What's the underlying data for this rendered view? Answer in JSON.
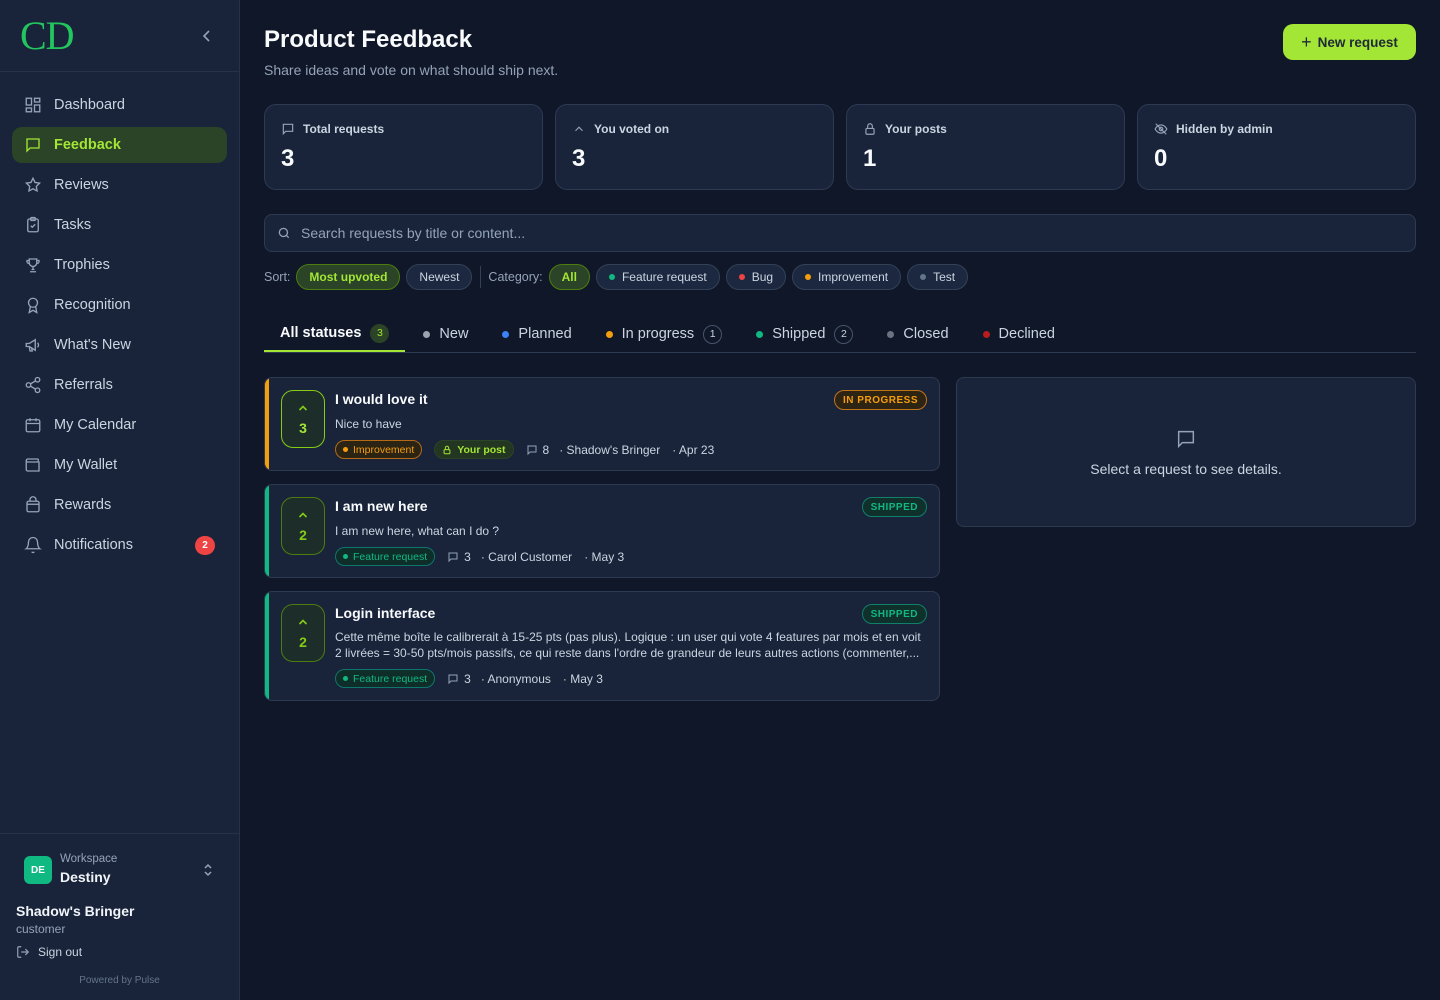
{
  "sidebar": {
    "logo": "CD",
    "nav": [
      {
        "label": "Dashboard",
        "icon": "dashboard-icon"
      },
      {
        "label": "Feedback",
        "icon": "chat-bubble-icon",
        "active": true
      },
      {
        "label": "Reviews",
        "icon": "star-icon"
      },
      {
        "label": "Tasks",
        "icon": "clipboard-icon"
      },
      {
        "label": "Trophies",
        "icon": "trophy-icon"
      },
      {
        "label": "Recognition",
        "icon": "award-icon"
      },
      {
        "label": "What's New",
        "icon": "megaphone-icon"
      },
      {
        "label": "Referrals",
        "icon": "share-icon"
      },
      {
        "label": "My Calendar",
        "icon": "calendar-icon"
      },
      {
        "label": "My Wallet",
        "icon": "wallet-icon"
      },
      {
        "label": "Rewards",
        "icon": "gift-icon"
      },
      {
        "label": "Notifications",
        "icon": "bell-icon",
        "badge": "2"
      }
    ],
    "workspace": {
      "label": "Workspace",
      "name": "Destiny",
      "initials": "DE"
    },
    "user": {
      "name": "Shadow's Bringer",
      "role": "customer"
    },
    "sign_out": "Sign out",
    "powered_by": "Powered by Pulse"
  },
  "header": {
    "title": "Product Feedback",
    "subtitle": "Share ideas and vote on what should ship next.",
    "new_button": "New request"
  },
  "stats": [
    {
      "label": "Total requests",
      "value": "3",
      "icon": "chat-bubble-icon"
    },
    {
      "label": "You voted on",
      "value": "3",
      "icon": "chevron-up-icon"
    },
    {
      "label": "Your posts",
      "value": "1",
      "icon": "lock-icon"
    },
    {
      "label": "Hidden by admin",
      "value": "0",
      "icon": "eye-off-icon"
    }
  ],
  "search": {
    "placeholder": "Search requests by title or content...",
    "value": ""
  },
  "filters": {
    "sort_label": "Sort:",
    "sort": [
      {
        "label": "Most upvoted",
        "active": true
      },
      {
        "label": "Newest"
      }
    ],
    "category_label": "Category:",
    "categories": [
      {
        "label": "All",
        "active": true
      },
      {
        "label": "Feature request",
        "color": "#10b981"
      },
      {
        "label": "Bug",
        "color": "#ef4444"
      },
      {
        "label": "Improvement",
        "color": "#f59e0b"
      },
      {
        "label": "Test",
        "color": "#64748b"
      }
    ]
  },
  "tabs": [
    {
      "label": "All statuses",
      "count": "3",
      "active": true
    },
    {
      "label": "New",
      "color": "#9ca3af"
    },
    {
      "label": "Planned",
      "color": "#3b82f6"
    },
    {
      "label": "In progress",
      "color": "#f59e0b",
      "count": "1"
    },
    {
      "label": "Shipped",
      "color": "#10b981",
      "count": "2"
    },
    {
      "label": "Closed",
      "color": "#6b7280"
    },
    {
      "label": "Declined",
      "color": "#b91c1c"
    }
  ],
  "requests": [
    {
      "votes": "3",
      "title": "I would love it",
      "description": "Nice to have",
      "status": "IN PROGRESS",
      "category": "Improvement",
      "own_post_label": "Your post",
      "comments": "8",
      "author": "· Shadow's Bringer",
      "date": "· Apr 23"
    },
    {
      "votes": "2",
      "title": "I am new here",
      "description": "I am new here, what can I do ?",
      "status": "SHIPPED",
      "category": "Feature request",
      "comments": "3",
      "author": "· Carol Customer",
      "date": "· May 3"
    },
    {
      "votes": "2",
      "title": "Login interface",
      "description": "Cette même boîte le calibrerait à 15-25 pts (pas plus). Logique : un user qui vote 4 features par mois et en voit 2 livrées = 30-50 pts/mois passifs, ce qui reste dans l'ordre de grandeur de leurs autres actions (commenter,...",
      "status": "SHIPPED",
      "category": "Feature request",
      "comments": "3",
      "author": "· Anonymous",
      "date": "· May 3"
    }
  ],
  "detail": {
    "empty_text": "Select a request to see details."
  },
  "colors": {
    "accent": "#a3e635",
    "in_progress": "#f59e0b",
    "shipped": "#10b981",
    "notification": "#ef4444"
  }
}
